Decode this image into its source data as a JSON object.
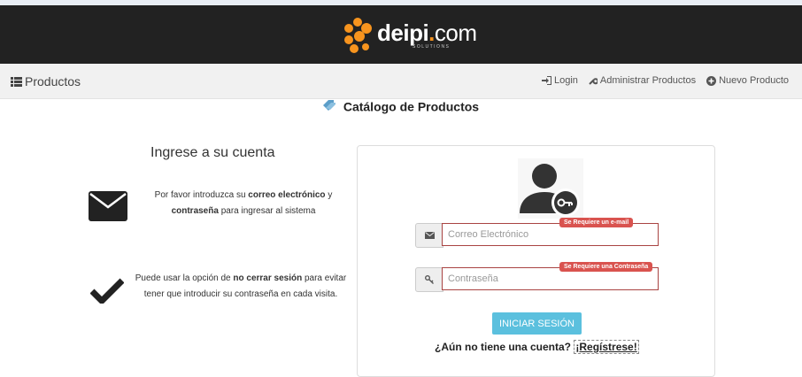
{
  "brand": {
    "logo_main": "deipi",
    "logo_dot": ".",
    "logo_com": "com",
    "logo_sub": "SOLUTIONS",
    "accent_color": "#f7941e"
  },
  "navbar": {
    "brand_label": "Productos",
    "brand_icon": "list-icon",
    "links": [
      {
        "label": "Login",
        "icon": "sign-in-icon"
      },
      {
        "label": "Administrar Productos",
        "icon": "wrench-icon"
      },
      {
        "label": "Nuevo Producto",
        "icon": "plus-circle-icon"
      }
    ]
  },
  "page": {
    "heading": "Catálogo de Productos",
    "heading_icon": "tag-icon"
  },
  "info": {
    "title": "Ingrese a su cuenta",
    "text1_part1": "Por favor introduzca su ",
    "text1_bold1": "correo electrónico",
    "text1_part2": " y ",
    "text1_bold2": "contraseña",
    "text1_part3": " para ingresar al sistema",
    "text2_part1": "Puede usar la opción de ",
    "text2_bold": "no cerrar sesión",
    "text2_part2": " para evitar tener que introducir su contraseña en cada visita."
  },
  "form": {
    "email_placeholder": "Correo Electrónico",
    "email_error": "Se Requiere un e-mail",
    "password_placeholder": "Contraseña",
    "password_error": "Se Requiere una Contraseña",
    "submit_label": "INICIAR SESIÓN",
    "register_prompt": "¿Aún no tiene una cuenta?",
    "register_link": "¡Regístrese!",
    "error_color": "#d9534f",
    "button_color": "#5bc0de"
  }
}
